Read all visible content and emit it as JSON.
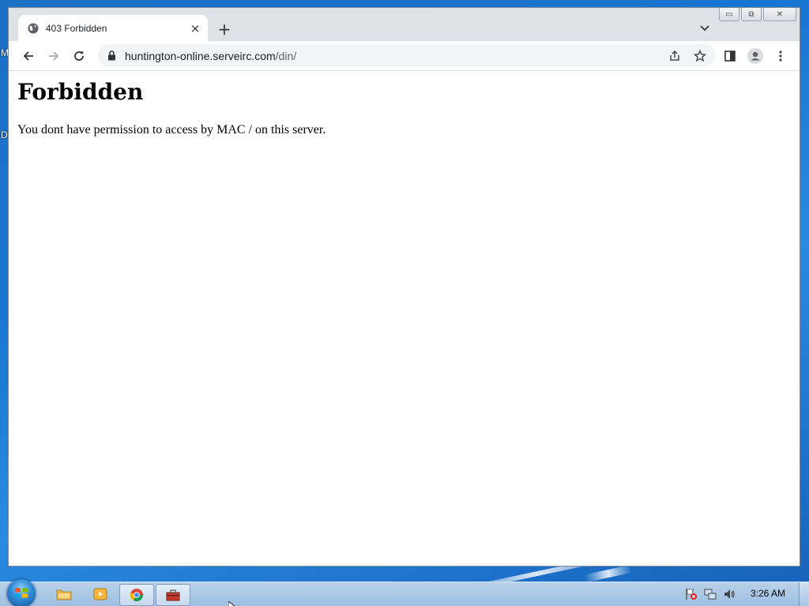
{
  "desktop": {
    "peek_letters": [
      "M",
      "D"
    ]
  },
  "browser": {
    "tab": {
      "title": "403 Forbidden",
      "favicon": "globe-icon",
      "close": "×"
    },
    "new_tab": "+",
    "url": {
      "host": "huntington-online.serveirc.com",
      "path": "/din/"
    },
    "window_controls": {
      "minimize": "▭",
      "restore": "⧉",
      "close": "✕"
    }
  },
  "page": {
    "heading": "Forbidden",
    "message": "You dont have permission to access by MAC / on this server."
  },
  "taskbar": {
    "apps": [
      "file-explorer-icon",
      "media-player-icon",
      "chrome-icon",
      "toolbox-icon"
    ],
    "active_app": "chrome-icon",
    "clock": "3:26 AM"
  },
  "colors": {
    "tab_active": "#ffffff",
    "tabstrip": "#dee1e6",
    "omnibox": "#f1f3f4",
    "desktop": "#1a76d2"
  }
}
